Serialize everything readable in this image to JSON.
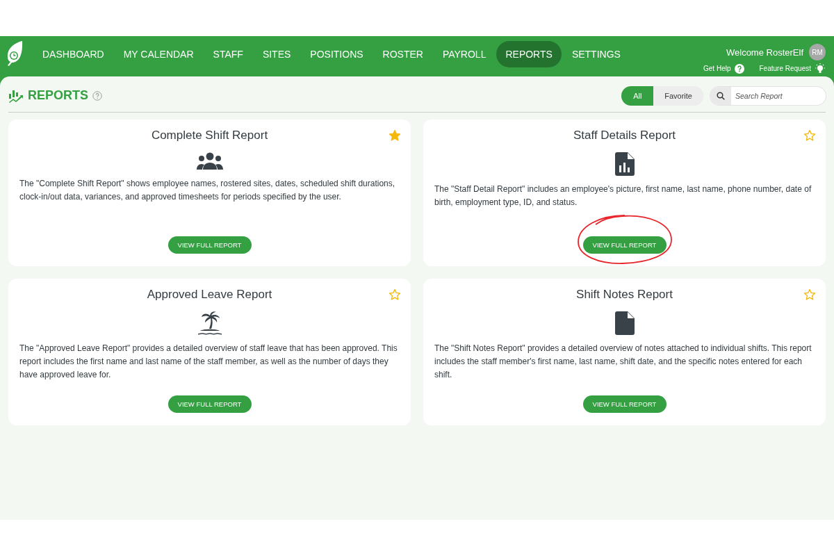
{
  "nav": {
    "items": [
      {
        "label": "DASHBOARD",
        "selected": false
      },
      {
        "label": "MY CALENDAR",
        "selected": false
      },
      {
        "label": "STAFF",
        "selected": false
      },
      {
        "label": "SITES",
        "selected": false
      },
      {
        "label": "POSITIONS",
        "selected": false
      },
      {
        "label": "ROSTER",
        "selected": false
      },
      {
        "label": "PAYROLL",
        "selected": false
      },
      {
        "label": "REPORTS",
        "selected": true
      },
      {
        "label": "SETTINGS",
        "selected": false
      }
    ],
    "welcome": "Welcome RosterElf",
    "avatar": "RM",
    "help": "Get Help",
    "feature": "Feature Request"
  },
  "page": {
    "title": "REPORTS",
    "filters": [
      {
        "label": "All",
        "selected": true
      },
      {
        "label": "Favorite",
        "selected": false
      }
    ],
    "search": {
      "placeholder": "Search Report"
    }
  },
  "reports": [
    {
      "title": "Complete Shift Report",
      "kind": "people",
      "favorite": true,
      "highlighted": false,
      "description": "The \"Complete Shift Report\" shows employee names, rostered sites, dates, scheduled shift durations, clock-in/out data, variances, and approved timesheets for periods specified by the user.",
      "button": "VIEW FULL REPORT"
    },
    {
      "title": "Staff Details Report",
      "kind": "chart-file",
      "favorite": false,
      "highlighted": true,
      "description": "The \"Staff Detail Report\" includes an employee's picture, first name, last name, phone number, date of birth, employment type, ID, and status.",
      "button": "VIEW FULL REPORT"
    },
    {
      "title": "Approved Leave Report",
      "kind": "island",
      "favorite": false,
      "highlighted": false,
      "description": "The \"Approved Leave Report\" provides a detailed overview of staff leave that has been approved. This report includes the first name and last name of the staff member, as well as the number of days they have approved leave for.",
      "button": "VIEW FULL REPORT"
    },
    {
      "title": "Shift Notes Report",
      "kind": "file",
      "favorite": false,
      "highlighted": false,
      "description": "The \"Shift Notes Report\" provides a detailed overview of notes attached to individual shifts. This report includes the staff member's first name, last name, shift date, and the specific notes entered for each shift.",
      "button": "VIEW FULL REPORT"
    }
  ]
}
